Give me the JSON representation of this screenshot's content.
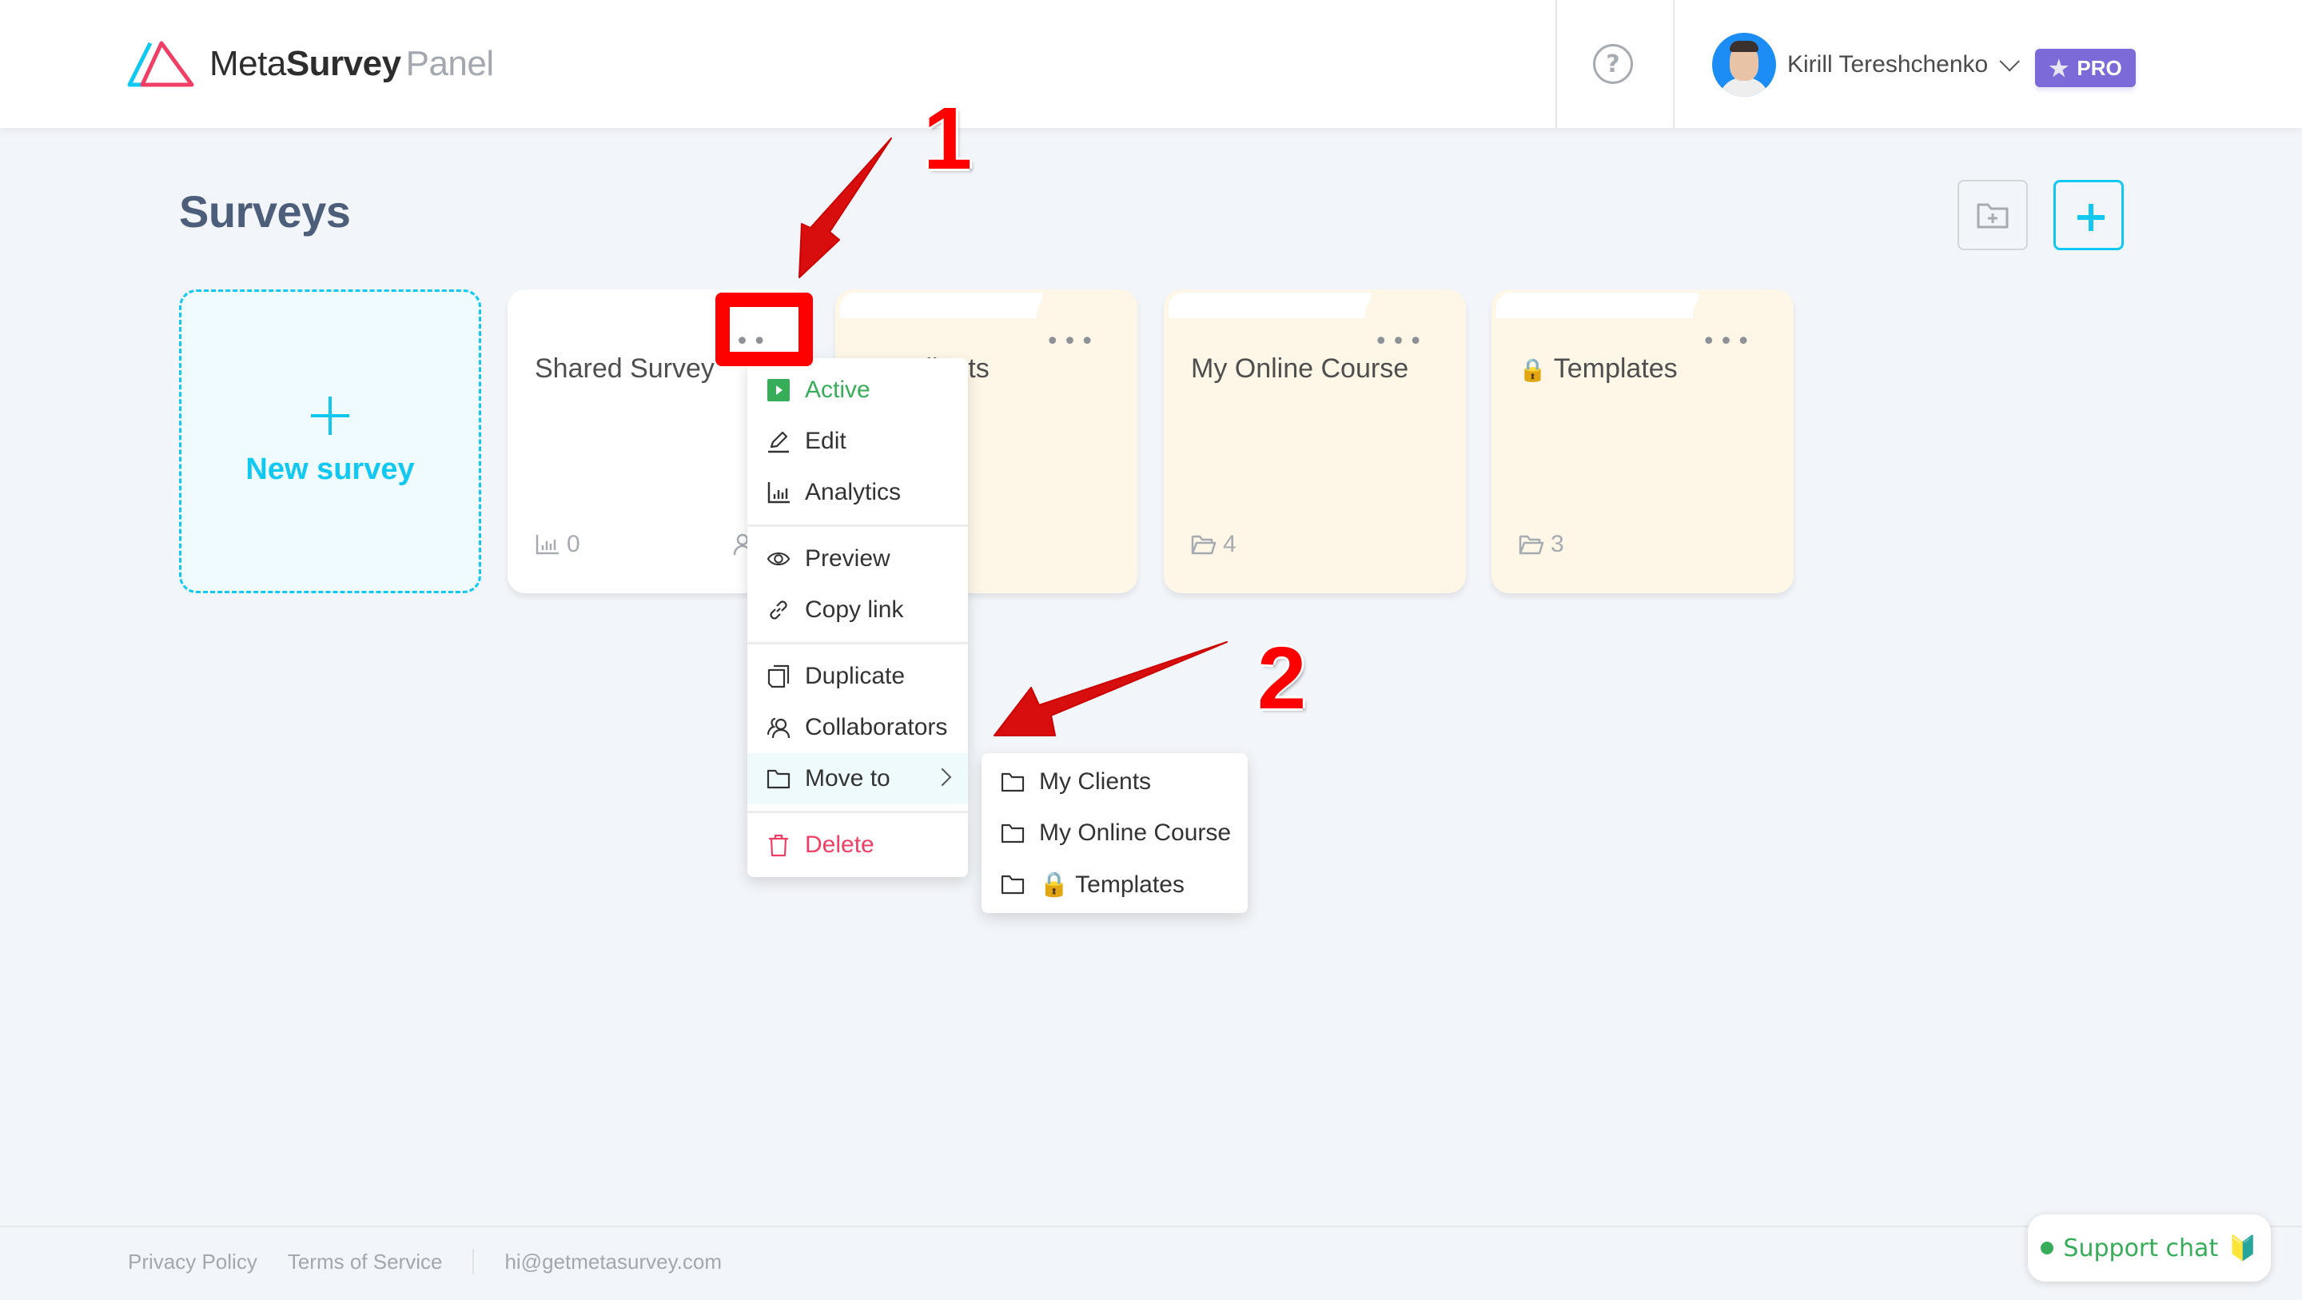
{
  "header": {
    "logo": {
      "part1": "Meta",
      "part2": "Survey",
      "part3": "Panel",
      "icon": "triangles-logo-icon"
    },
    "help_icon": "question-circle-icon",
    "user": {
      "name": "Kirill Tereshchenko",
      "avatar_icon": "user-avatar",
      "chevron_icon": "chevron-down-icon"
    },
    "pro_badge": {
      "label": "PRO",
      "icon": "star-icon",
      "color": "#7b6ad8"
    }
  },
  "page": {
    "title": "Surveys",
    "toolbar": {
      "new_folder_icon": "folder-plus-icon",
      "new_survey_icon": "plus-icon",
      "accent": "#10c8f2"
    }
  },
  "cards": {
    "new_survey": {
      "label": "New survey",
      "icon": "plus-icon"
    },
    "items": [
      {
        "type": "survey",
        "title": "Shared Survey",
        "responses": "0",
        "menu_icon": "more-dots-icon"
      },
      {
        "type": "folder",
        "title": "My Clients",
        "count": "",
        "menu_icon": "more-dots-icon"
      },
      {
        "type": "folder",
        "title": "My Online Course",
        "count": "4",
        "menu_icon": "more-dots-icon"
      },
      {
        "type": "folder",
        "title": "Templates",
        "locked": true,
        "lock_emoji": "🔒",
        "count": "3",
        "menu_icon": "more-dots-icon"
      }
    ],
    "folder_bg": "#fef7e8"
  },
  "context_menu": {
    "groups": [
      [
        {
          "label": "Active",
          "icon": "play-square-icon",
          "style": "active"
        },
        {
          "label": "Edit",
          "icon": "pencil-icon"
        },
        {
          "label": "Analytics",
          "icon": "bar-chart-icon"
        }
      ],
      [
        {
          "label": "Preview",
          "icon": "eye-icon"
        },
        {
          "label": "Copy link",
          "icon": "link-icon"
        }
      ],
      [
        {
          "label": "Duplicate",
          "icon": "copy-icon"
        },
        {
          "label": "Collaborators",
          "icon": "users-icon"
        },
        {
          "label": "Move to",
          "icon": "folder-icon",
          "has_submenu": true,
          "highlighted": true
        }
      ],
      [
        {
          "label": "Delete",
          "icon": "trash-icon",
          "style": "danger"
        }
      ]
    ],
    "colors": {
      "active": "#37ad5a",
      "danger": "#f03e64"
    }
  },
  "move_to_submenu": [
    {
      "label": "My Clients",
      "icon": "folder-icon"
    },
    {
      "label": "My Online Course",
      "icon": "folder-icon"
    },
    {
      "label": "🔒 Templates",
      "icon": "folder-icon"
    }
  ],
  "annotations": [
    {
      "number": "1",
      "target": "Shared Survey more menu"
    },
    {
      "number": "2",
      "target": "Move to"
    }
  ],
  "footer": {
    "links": [
      "Privacy Policy",
      "Terms of Service"
    ],
    "email": "hi@getmetasurvey.com"
  },
  "support_chat": {
    "label": "Support chat",
    "emoji": "🔰",
    "status_color": "#37ad5a"
  }
}
